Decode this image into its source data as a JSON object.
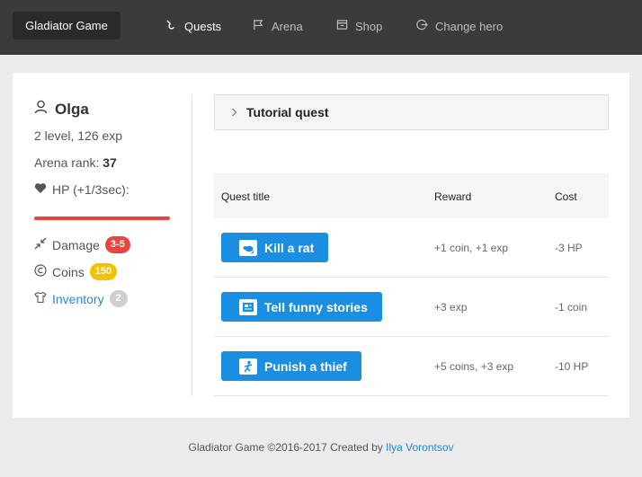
{
  "nav": {
    "brand": "Gladiator Game",
    "items": [
      {
        "label": "Quests",
        "icon": "quest-icon",
        "active": true
      },
      {
        "label": "Arena",
        "icon": "flag-icon",
        "active": false
      },
      {
        "label": "Shop",
        "icon": "shop-icon",
        "active": false
      },
      {
        "label": "Change hero",
        "icon": "logout-icon",
        "active": false
      }
    ]
  },
  "hero": {
    "name": "Olga",
    "level_exp": "2 level, 126 exp",
    "arena_rank_label": "Arena rank:",
    "arena_rank": "37",
    "hp_label": "HP (+1/3sec):",
    "hp_fraction": 1.0,
    "damage_label": "Damage",
    "damage": "3-5",
    "coins_label": "Coins",
    "coins": "150",
    "inventory_label": "Inventory",
    "inventory_count": "2"
  },
  "quests": {
    "accordion_title": "Tutorial quest",
    "headers": {
      "title": "Quest title",
      "reward": "Reward",
      "cost": "Cost"
    },
    "rows": [
      {
        "title": "Kill a rat",
        "reward": "+1 coin, +1 exp",
        "cost": "-3 HP",
        "icon": "rat-icon"
      },
      {
        "title": "Tell funny stories",
        "reward": "+3 exp",
        "cost": "-1 coin",
        "icon": "story-icon"
      },
      {
        "title": "Punish a thief",
        "reward": "+5 coins, +3 exp",
        "cost": "-10 HP",
        "icon": "thief-icon"
      }
    ]
  },
  "footer": {
    "text": "Gladiator Game ©2016-2017 Created by",
    "author": "Ilya Vorontsov"
  },
  "colors": {
    "navbar": "#3b3b3b",
    "accent_blue": "#1a8ee0",
    "hp_red": "#e8453c",
    "coins_yellow": "#f5c000"
  }
}
